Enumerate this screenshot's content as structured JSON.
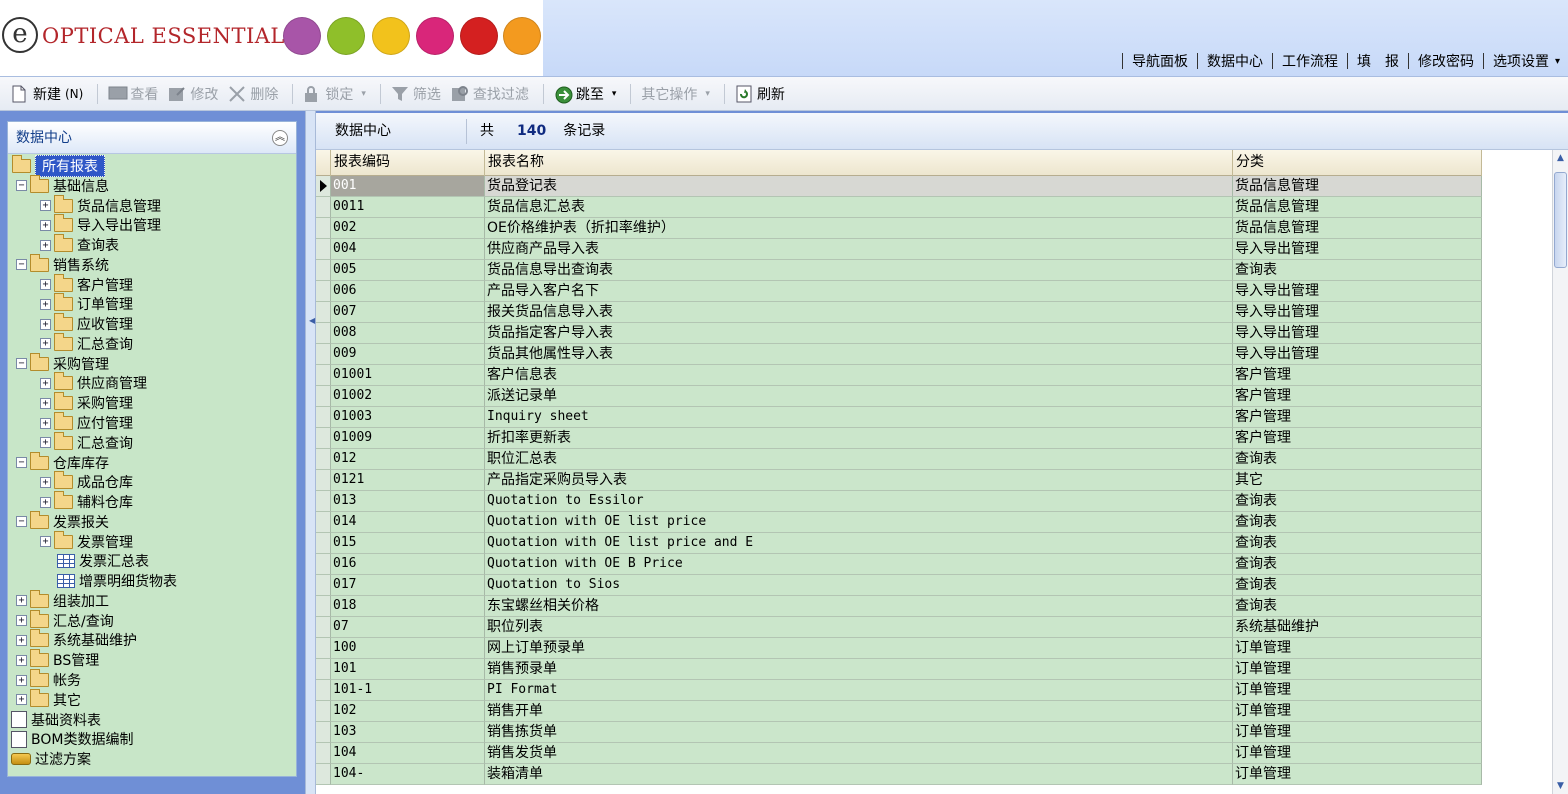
{
  "brand": {
    "logo_mark": "e",
    "logo_text": "OPTICAL ESSENTIALS",
    "logo_circle_colors": [
      "#a855a8",
      "#8fbf2a",
      "#f2c21c",
      "#d9267a",
      "#d42020",
      "#f39a1f"
    ]
  },
  "top_nav": {
    "items": [
      "导航面板",
      "数据中心",
      "工作流程",
      "填　报",
      "修改密码",
      "选项设置"
    ],
    "caret": "▾"
  },
  "toolbar": {
    "new": "新建",
    "new_shortcut": "(N)",
    "view": "查看",
    "edit": "修改",
    "delete": "删除",
    "lock": "锁定",
    "filter": "筛选",
    "search_filter": "查找过滤",
    "jump": "跳至",
    "other_ops": "其它操作",
    "refresh": "刷新",
    "caret": "▾"
  },
  "left_panel": {
    "title": "数据中心",
    "collapse_glyph": "︽",
    "tree": [
      {
        "label": "所有报表",
        "type": "folder",
        "level": 0,
        "selected": true
      },
      {
        "label": "基础信息",
        "type": "folder",
        "level": 1,
        "expander": "−"
      },
      {
        "label": "货品信息管理",
        "type": "folder",
        "level": 2,
        "expander": "+"
      },
      {
        "label": "导入导出管理",
        "type": "folder",
        "level": 2,
        "expander": "+"
      },
      {
        "label": "查询表",
        "type": "folder",
        "level": 2,
        "expander": "+"
      },
      {
        "label": "销售系统",
        "type": "folder",
        "level": 1,
        "expander": "−"
      },
      {
        "label": "客户管理",
        "type": "folder",
        "level": 2,
        "expander": "+"
      },
      {
        "label": "订单管理",
        "type": "folder",
        "level": 2,
        "expander": "+"
      },
      {
        "label": "应收管理",
        "type": "folder",
        "level": 2,
        "expander": "+"
      },
      {
        "label": "汇总查询",
        "type": "folder",
        "level": 2,
        "expander": "+"
      },
      {
        "label": "采购管理",
        "type": "folder",
        "level": 1,
        "expander": "−"
      },
      {
        "label": "供应商管理",
        "type": "folder",
        "level": 2,
        "expander": "+"
      },
      {
        "label": "采购管理",
        "type": "folder",
        "level": 2,
        "expander": "+"
      },
      {
        "label": "应付管理",
        "type": "folder",
        "level": 2,
        "expander": "+"
      },
      {
        "label": "汇总查询",
        "type": "folder",
        "level": 2,
        "expander": "+"
      },
      {
        "label": "仓库库存",
        "type": "folder",
        "level": 1,
        "expander": "−"
      },
      {
        "label": "成品仓库",
        "type": "folder",
        "level": 2,
        "expander": "+"
      },
      {
        "label": "辅料仓库",
        "type": "folder",
        "level": 2,
        "expander": "+"
      },
      {
        "label": "发票报关",
        "type": "folder",
        "level": 1,
        "expander": "−"
      },
      {
        "label": "发票管理",
        "type": "folder",
        "level": 2,
        "expander": "+"
      },
      {
        "label": "发票汇总表",
        "type": "table",
        "level": 2
      },
      {
        "label": "增票明细货物表",
        "type": "table",
        "level": 2
      },
      {
        "label": "组装加工",
        "type": "folder",
        "level": 1,
        "expander": "+"
      },
      {
        "label": "汇总/查询",
        "type": "folder",
        "level": 1,
        "expander": "+"
      },
      {
        "label": "系统基础维护",
        "type": "folder",
        "level": 1,
        "expander": "+"
      },
      {
        "label": "BS管理",
        "type": "folder",
        "level": 1,
        "expander": "+"
      },
      {
        "label": "帐务",
        "type": "folder",
        "level": 1,
        "expander": "+"
      },
      {
        "label": "其它",
        "type": "folder",
        "level": 1,
        "expander": "+"
      },
      {
        "label": "基础资料表",
        "type": "doc",
        "level": 0
      },
      {
        "label": "BOM类数据编制",
        "type": "doc",
        "level": 0
      },
      {
        "label": "过滤方案",
        "type": "filter",
        "level": 0
      }
    ]
  },
  "main": {
    "title": "数据中心",
    "count_prefix": "共",
    "count": "140",
    "count_suffix": "条记录",
    "columns": [
      "报表编码",
      "报表名称",
      "分类"
    ],
    "rows": [
      [
        "001",
        "货品登记表",
        "货品信息管理"
      ],
      [
        "0011",
        "货品信息汇总表",
        "货品信息管理"
      ],
      [
        "002",
        "OE价格维护表（折扣率维护）",
        "货品信息管理"
      ],
      [
        "004",
        "供应商产品导入表",
        "导入导出管理"
      ],
      [
        "005",
        "货品信息导出查询表",
        "查询表"
      ],
      [
        "006",
        "产品导入客户名下",
        "导入导出管理"
      ],
      [
        "007",
        "报关货品信息导入表",
        "导入导出管理"
      ],
      [
        "008",
        "货品指定客户导入表",
        "导入导出管理"
      ],
      [
        "009",
        "货品其他属性导入表",
        "导入导出管理"
      ],
      [
        "01001",
        "客户信息表",
        "客户管理"
      ],
      [
        "01002",
        "派送记录单",
        "客户管理"
      ],
      [
        "01003",
        "Inquiry sheet",
        "客户管理"
      ],
      [
        "01009",
        "折扣率更新表",
        "客户管理"
      ],
      [
        "012",
        "职位汇总表",
        "查询表"
      ],
      [
        "0121",
        "产品指定采购员导入表",
        "其它"
      ],
      [
        "013",
        "Quotation to Essilor",
        "查询表"
      ],
      [
        "014",
        "Quotation with OE list price",
        "查询表"
      ],
      [
        "015",
        "Quotation with OE list price and E",
        "查询表"
      ],
      [
        "016",
        "Quotation with OE B Price",
        "查询表"
      ],
      [
        "017",
        "Quotation to Sios",
        "查询表"
      ],
      [
        "018",
        "东宝螺丝相关价格",
        "查询表"
      ],
      [
        "07",
        "职位列表",
        "系统基础维护"
      ],
      [
        "100",
        "网上订单预录单",
        "订单管理"
      ],
      [
        "101",
        "销售预录单",
        "订单管理"
      ],
      [
        "101-1",
        "PI Format",
        "订单管理"
      ],
      [
        "102",
        "销售开单",
        "订单管理"
      ],
      [
        "103",
        "销售拣货单",
        "订单管理"
      ],
      [
        "104",
        "销售发货单",
        "订单管理"
      ],
      [
        "104-",
        "装箱清单",
        "订单管理"
      ]
    ],
    "selected_row": 0
  },
  "scrollbar": {
    "up": "▲",
    "down": "▼"
  },
  "splitter": {
    "arrow": "◀"
  }
}
